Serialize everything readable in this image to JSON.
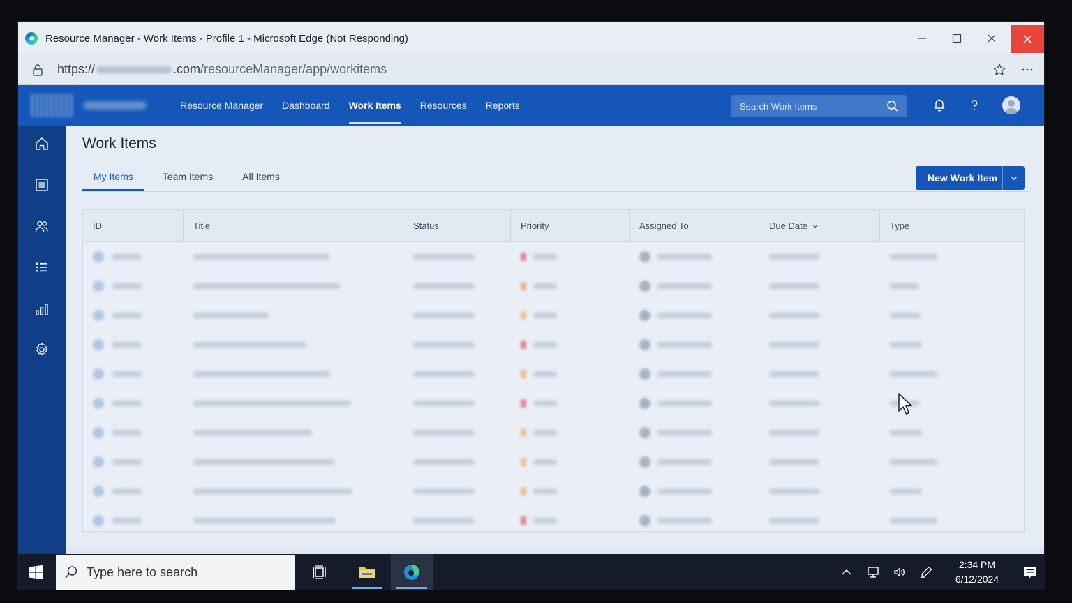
{
  "window": {
    "title": "Resource Manager - Work Items - Profile 1 - Microsoft Edge (Not Responding)"
  },
  "address": {
    "scheme": "https://",
    "host_end": ".com",
    "path": "/resourceManager/app/workitems"
  },
  "nav": {
    "links": [
      "Resource Manager",
      "Dashboard",
      "Work Items",
      "Resources",
      "Reports"
    ],
    "active": "Work Items",
    "search_placeholder": "Search Work Items"
  },
  "page": {
    "title": "Work Items",
    "tabs": [
      "My Items",
      "Team Items",
      "All Items"
    ],
    "active_tab": "My Items",
    "new_button": "New Work Item"
  },
  "table": {
    "columns": [
      "ID",
      "Title",
      "Status",
      "Priority",
      "Assigned To",
      "Due Date",
      "Type"
    ],
    "sort_column": "Due Date",
    "row_count": 10,
    "priority_colors": [
      "#e28a93",
      "#f0b48a",
      "#f0c48a",
      "#e28a93",
      "#f0c08a",
      "#e28a93",
      "#f0c48a",
      "#f0c48a",
      "#f0c48a",
      "#e28a93"
    ]
  },
  "taskbar": {
    "search_placeholder": "Type here to search",
    "time": "2:34 PM",
    "date": "6/12/2024"
  },
  "colors": {
    "accent": "#1557b8",
    "rail": "#0f3f86",
    "close": "#e8453a"
  }
}
